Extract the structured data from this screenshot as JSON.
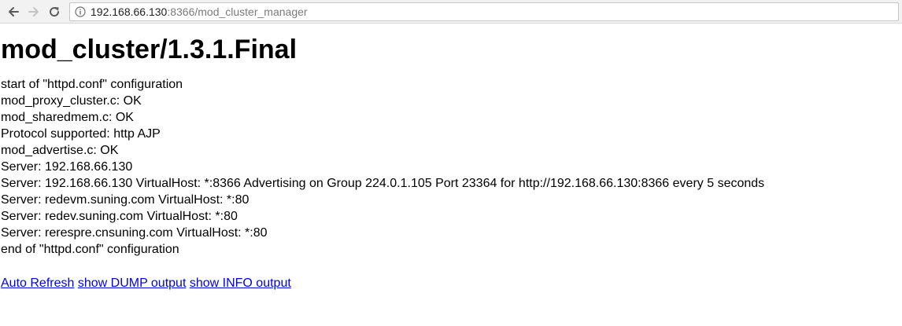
{
  "browser": {
    "url_host": "192.168.66.130",
    "url_rest": ":8366/mod_cluster_manager",
    "back_icon": "back-arrow-icon",
    "forward_icon": "forward-arrow-icon",
    "reload_icon": "reload-icon",
    "info_icon": "info-icon"
  },
  "page": {
    "title": "mod_cluster/1.3.1.Final",
    "lines": [
      "start of \"httpd.conf\" configuration",
      "mod_proxy_cluster.c: OK",
      "mod_sharedmem.c: OK",
      "Protocol supported: http AJP",
      "mod_advertise.c: OK",
      "Server: 192.168.66.130",
      "Server: 192.168.66.130 VirtualHost: *:8366 Advertising on Group 224.0.1.105 Port 23364 for http://192.168.66.130:8366 every 5 seconds",
      "Server: redevm.suning.com VirtualHost: *:80",
      "Server: redev.suning.com VirtualHost: *:80",
      "Server: rerespre.cnsuning.com VirtualHost: *:80",
      "end of \"httpd.conf\" configuration"
    ],
    "links": {
      "auto_refresh": "Auto Refresh",
      "show_dump": "show DUMP output",
      "show_info": "show INFO output"
    }
  }
}
